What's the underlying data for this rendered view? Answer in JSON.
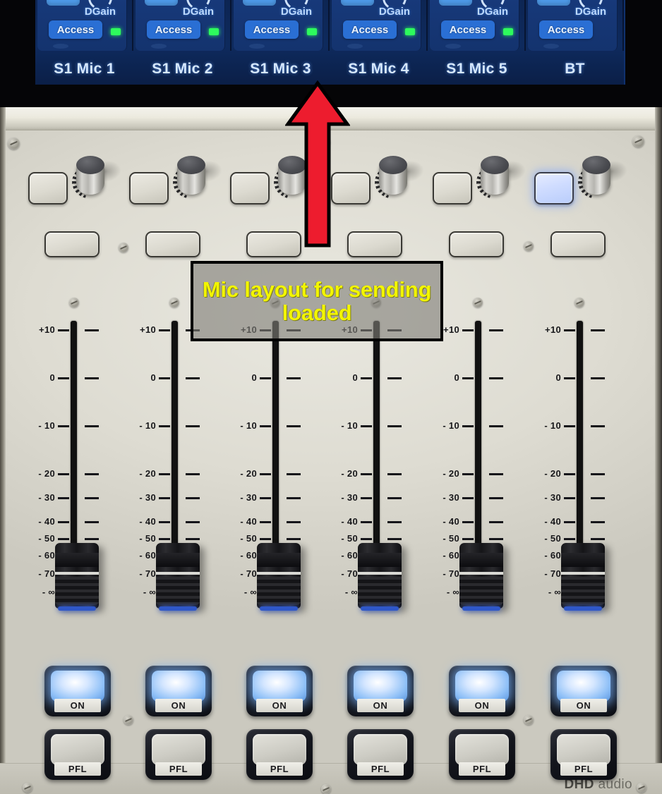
{
  "device": {
    "brand": "DHD",
    "brand_suffix": " audio",
    "type": "audio-mixing-console"
  },
  "screen": {
    "channels": [
      {
        "name": "S1 Mic 1",
        "dgain_label": "DGain",
        "access_label": "Access",
        "mini_button_label": "",
        "signal_led": true
      },
      {
        "name": "S1 Mic 2",
        "dgain_label": "DGain",
        "access_label": "Access",
        "mini_button_label": "",
        "signal_led": true
      },
      {
        "name": "S1 Mic 3",
        "dgain_label": "DGain",
        "access_label": "Access",
        "mini_button_label": "",
        "signal_led": true
      },
      {
        "name": "S1 Mic 4",
        "dgain_label": "DGain",
        "access_label": "Access",
        "mini_button_label": "",
        "signal_led": true
      },
      {
        "name": "S1 Mic 5",
        "dgain_label": "DGain",
        "access_label": "Access",
        "mini_button_label": "",
        "signal_led": true
      },
      {
        "name": "BT",
        "dgain_label": "DGain",
        "access_label": "Access",
        "mini_button_label": "",
        "signal_led": false
      }
    ],
    "colors": {
      "background": "#0d2553",
      "strip": "#17397a",
      "access_button": "#2a6fd4",
      "mini_button": "#4e9ae8",
      "label_text": "#d6e8ff",
      "led_green": "#2dfb5d"
    }
  },
  "annotation": {
    "text": "Mic layout for sending loaded",
    "text_color": "#f2f500",
    "box_border_color": "#000000",
    "arrow_color": "#ed1c2e",
    "arrow_outline_color": "#000000",
    "arrow_direction": "up"
  },
  "panel": {
    "fader_scale": [
      "+10",
      "0",
      "- 10",
      "- 20",
      "- 30",
      "- 40",
      "- 50",
      "- 60",
      "- 70",
      "- ∞"
    ],
    "channel_strips": [
      {
        "index": 1,
        "select_button_lit": false,
        "on_label": "ON",
        "on_lit": true,
        "pfl_label": "PFL",
        "pfl_lit": false,
        "fader_position": "-∞"
      },
      {
        "index": 2,
        "select_button_lit": false,
        "on_label": "ON",
        "on_lit": true,
        "pfl_label": "PFL",
        "pfl_lit": false,
        "fader_position": "-∞"
      },
      {
        "index": 3,
        "select_button_lit": false,
        "on_label": "ON",
        "on_lit": true,
        "pfl_label": "PFL",
        "pfl_lit": false,
        "fader_position": "-∞"
      },
      {
        "index": 4,
        "select_button_lit": false,
        "on_label": "ON",
        "on_lit": true,
        "pfl_label": "PFL",
        "pfl_lit": false,
        "fader_position": "-∞"
      },
      {
        "index": 5,
        "select_button_lit": false,
        "on_label": "ON",
        "on_lit": true,
        "pfl_label": "PFL",
        "pfl_lit": false,
        "fader_position": "-∞"
      },
      {
        "index": 6,
        "select_button_lit": true,
        "on_label": "ON",
        "on_lit": true,
        "pfl_label": "PFL",
        "pfl_lit": false,
        "fader_position": "-∞"
      }
    ],
    "colors": {
      "surface": "#ddd bc",
      "surface_hex": "#dedcd2",
      "lit_button": "#b9cdfb",
      "on_glow": "#8fc0f7"
    }
  }
}
